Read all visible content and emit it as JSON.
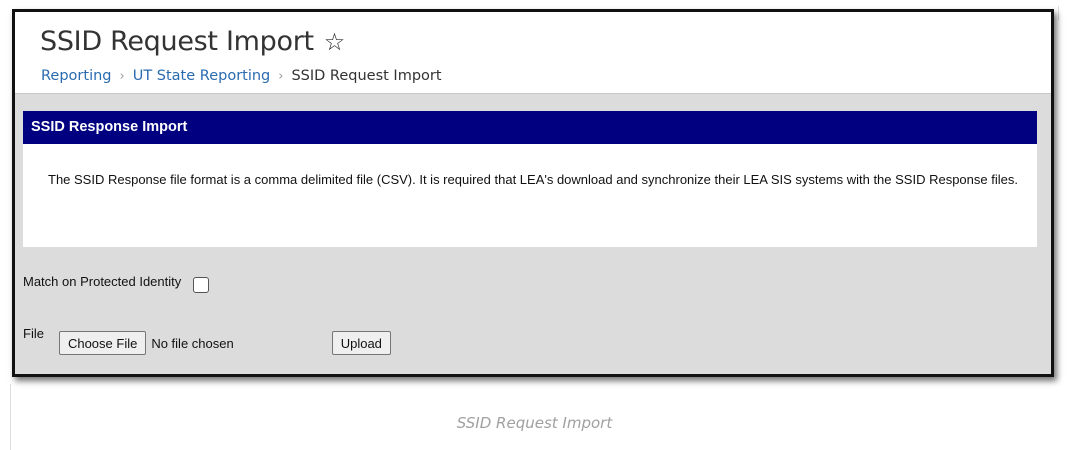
{
  "header": {
    "title": "SSID Request Import",
    "star_icon": "☆",
    "breadcrumb": [
      {
        "label": "Reporting"
      },
      {
        "label": "UT State Reporting"
      },
      {
        "label": "SSID Request Import"
      }
    ],
    "separator": "›"
  },
  "panel": {
    "heading": "SSID Response Import",
    "description": "The SSID Response file format is a comma delimited file (CSV). It is required that LEA's download and synchronize their LEA SIS systems with the SSID Response files."
  },
  "form": {
    "identity_label": "Match on Protected Identity",
    "identity_checked": false,
    "file_label": "File",
    "choose_file_label": "Choose File",
    "no_file_text": "No file chosen",
    "upload_label": "Upload"
  },
  "caption": "SSID Request Import",
  "colors": {
    "panel_header": "#000080",
    "link": "#2a6bb0",
    "content_bg": "#dcdcdc"
  }
}
